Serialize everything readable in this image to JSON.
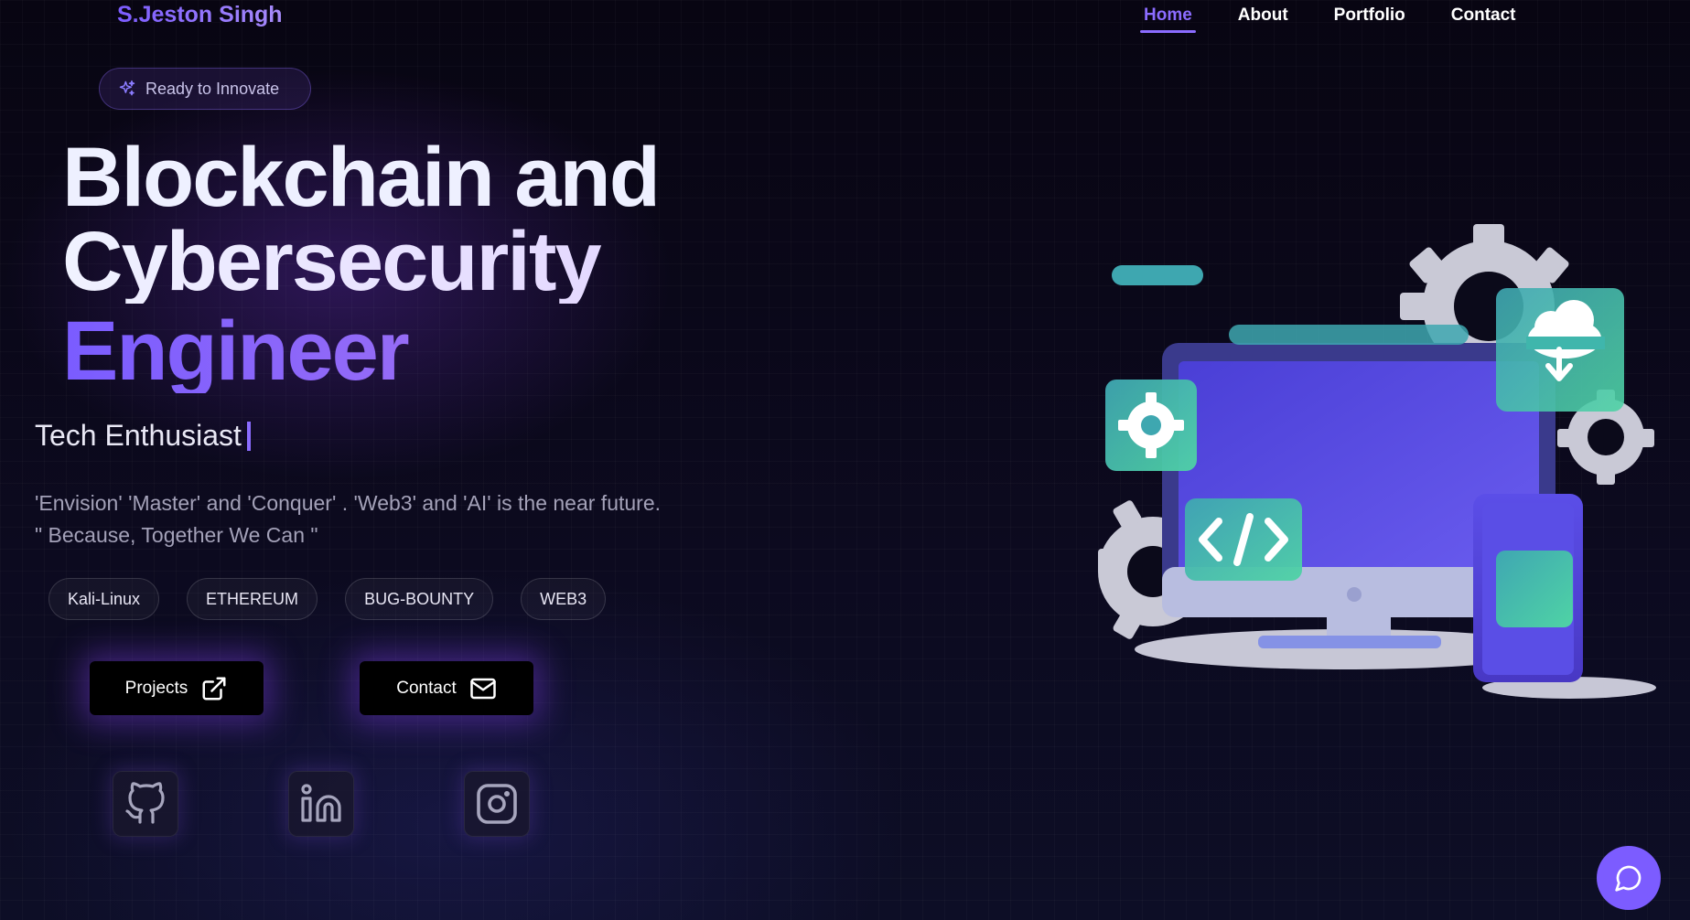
{
  "header": {
    "brand": "S.Jeston Singh",
    "nav": [
      {
        "label": "Home",
        "active": true
      },
      {
        "label": "About",
        "active": false
      },
      {
        "label": "Portfolio",
        "active": false
      },
      {
        "label": "Contact",
        "active": false
      }
    ]
  },
  "hero": {
    "badge": "Ready to Innovate",
    "title_line1": "Blockchain and",
    "title_line2": "Cybersecurity",
    "title_line3": "Engineer",
    "role": "Tech Enthusiast",
    "description_line1": "'Envision' 'Master' and 'Conquer' . 'Web3' and 'AI' is the near future.",
    "description_line2": "\" Because, Together We Can \"",
    "tags": [
      "Kali-Linux",
      "ETHEREUM",
      "BUG-BOUNTY",
      "WEB3"
    ],
    "buttons": {
      "projects": "Projects",
      "contact": "Contact"
    }
  },
  "social": [
    "github-icon",
    "linkedin-icon",
    "instagram-icon"
  ],
  "colors": {
    "accent": "#7c5cff",
    "background": "#07050f",
    "teal": "#3fbfa6"
  }
}
